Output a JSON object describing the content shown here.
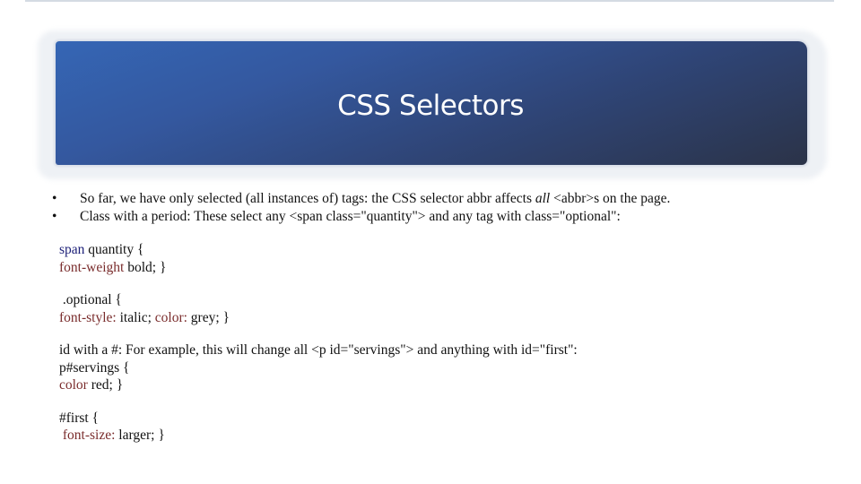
{
  "slide": {
    "title": "CSS Selectors",
    "bullets": [
      {
        "before": "So far, we have only selected (all instances of) tags: the CSS selector abbr affects ",
        "emphasis": "all",
        "after": " <abbr>s on the page."
      },
      {
        "text": "Class with a period: These select any <span class=\"quantity\"> and any tag with class=\"optional\":"
      }
    ],
    "code_blocks": [
      {
        "line1_tag": "span",
        "line1_rest": " quantity {",
        "line2_prop": "font-weight",
        "line2_rest": " bold; }"
      },
      {
        "line1_rest": " .optional {",
        "line2_prop": "font-style:",
        "line2_mid": " italic; ",
        "line2_prop2": "color:",
        "line2_rest": " grey; }"
      },
      {
        "intro": "id with a #: For example, this will change all <p id=\"servings\"> and anything with id=\"first\":",
        "line1_rest": "p#servings {",
        "line2_prop": "color",
        "line2_rest": " red; }"
      },
      {
        "line1_rest": "#first {",
        "line2_lead": " ",
        "line2_prop": "font-size:",
        "line2_rest": " larger; }"
      }
    ],
    "bullet_glyph": "•"
  },
  "colors": {
    "banner_start": "#3566b5",
    "banner_end": "#2b3348",
    "title_text": "#ffffff",
    "tag_color": "#1c1f78",
    "property_color": "#7a2c2c"
  }
}
